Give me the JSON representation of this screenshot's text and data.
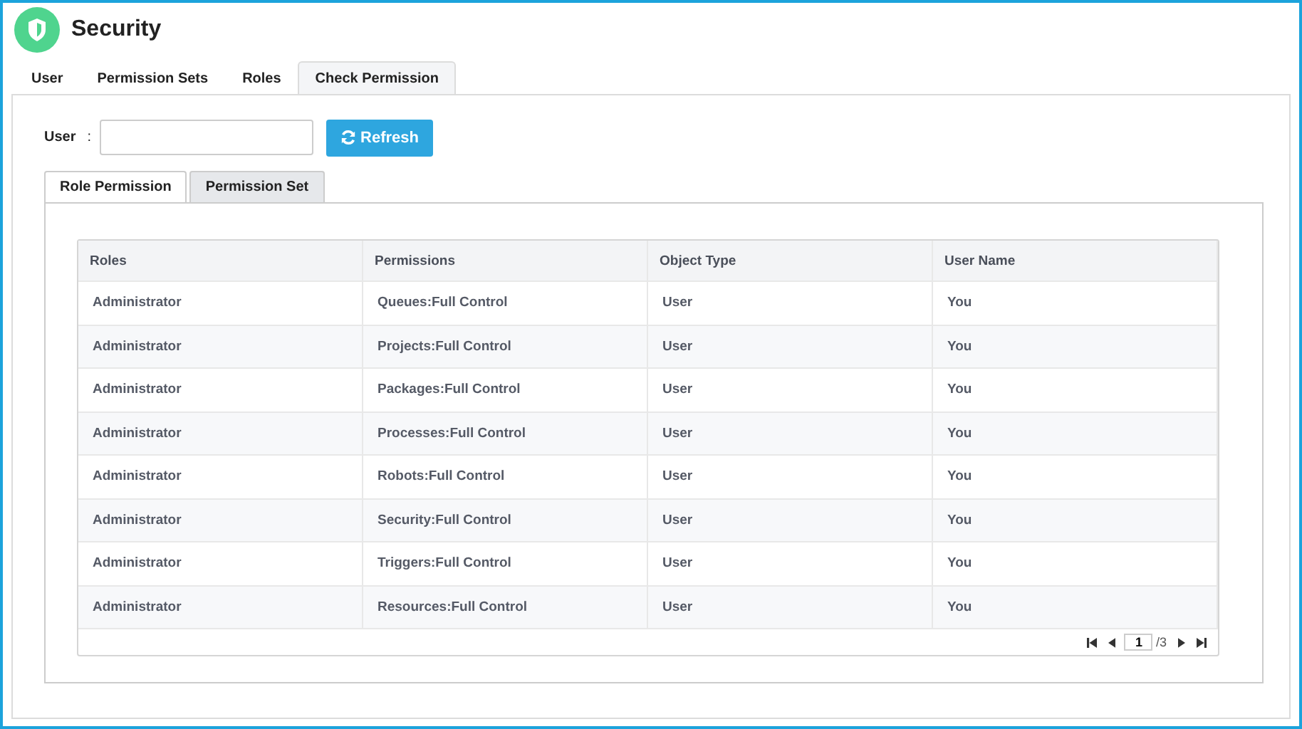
{
  "header": {
    "title": "Security"
  },
  "tabs": [
    {
      "label": "User",
      "selected": false
    },
    {
      "label": "Permission Sets",
      "selected": false
    },
    {
      "label": "Roles",
      "selected": false
    },
    {
      "label": "Check Permission",
      "selected": true
    }
  ],
  "user_field": {
    "label": "User",
    "separator": ":"
  },
  "refresh_button": {
    "label": "Refresh"
  },
  "sub_tabs": [
    {
      "label": "Role Permission",
      "selected": true
    },
    {
      "label": "Permission Set",
      "selected": false
    }
  ],
  "table": {
    "columns": [
      "Roles",
      "Permissions",
      "Object Type",
      "User Name"
    ],
    "rows": [
      [
        "Administrator",
        "Queues:Full Control",
        "User",
        "You"
      ],
      [
        "Administrator",
        "Projects:Full Control",
        "User",
        "You"
      ],
      [
        "Administrator",
        "Packages:Full Control",
        "User",
        "You"
      ],
      [
        "Administrator",
        "Processes:Full Control",
        "User",
        "You"
      ],
      [
        "Administrator",
        "Robots:Full Control",
        "User",
        "You"
      ],
      [
        "Administrator",
        "Security:Full Control",
        "User",
        "You"
      ],
      [
        "Administrator",
        "Triggers:Full Control",
        "User",
        "You"
      ],
      [
        "Administrator",
        "Resources:Full Control",
        "User",
        "You"
      ]
    ]
  },
  "pager": {
    "page": "1",
    "total": "/3"
  }
}
